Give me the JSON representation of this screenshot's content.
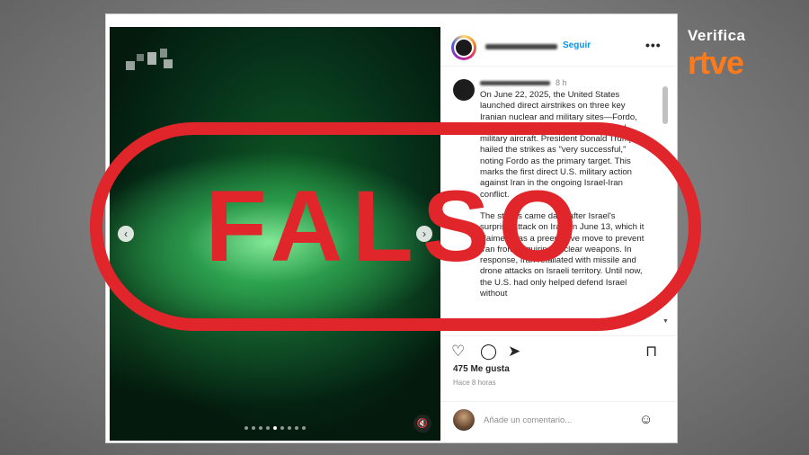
{
  "brand": {
    "top": "Verifica",
    "bottom": "rtve",
    "accent": "#ff7a1a"
  },
  "stamp": {
    "label": "FALSO",
    "color": "#e0262b"
  },
  "post": {
    "header": {
      "follow_label": "Seguir",
      "more_label": "•••"
    },
    "time_small": "8 h",
    "caption_paragraphs": [
      "On June 22, 2025, the United States launched direct airstrikes on three key Iranian nuclear and military sites—Fordo, Natanz, and Isfahan—using advanced military aircraft. President Donald Trump hailed the strikes as \"very successful,\" noting Fordo as the primary target. This marks the first direct U.S. military action against Iran in the ongoing Israel-Iran conflict.",
      "The strikes came days after Israel's surprise attack on Iran on June 13, which it claimed was a preemptive move to prevent Iran from acquiring nuclear weapons. In response, Iran retaliated with missile and drone attacks on Israeli territory. Until now, the U.S. had only helped defend Israel without"
    ],
    "likes": "475 Me gusta",
    "ago": "Hace 8 horas",
    "comment_placeholder": "Añade un comentario...",
    "carousel": {
      "total_slides": 9,
      "active_index": 4
    }
  },
  "icons": {
    "prev": "chevron-left-icon",
    "next": "chevron-right-icon",
    "like": "heart-icon",
    "comment": "comment-icon",
    "share": "send-icon",
    "save": "bookmark-icon",
    "emoji": "smiley-icon",
    "mute": "speaker-muted-icon"
  }
}
